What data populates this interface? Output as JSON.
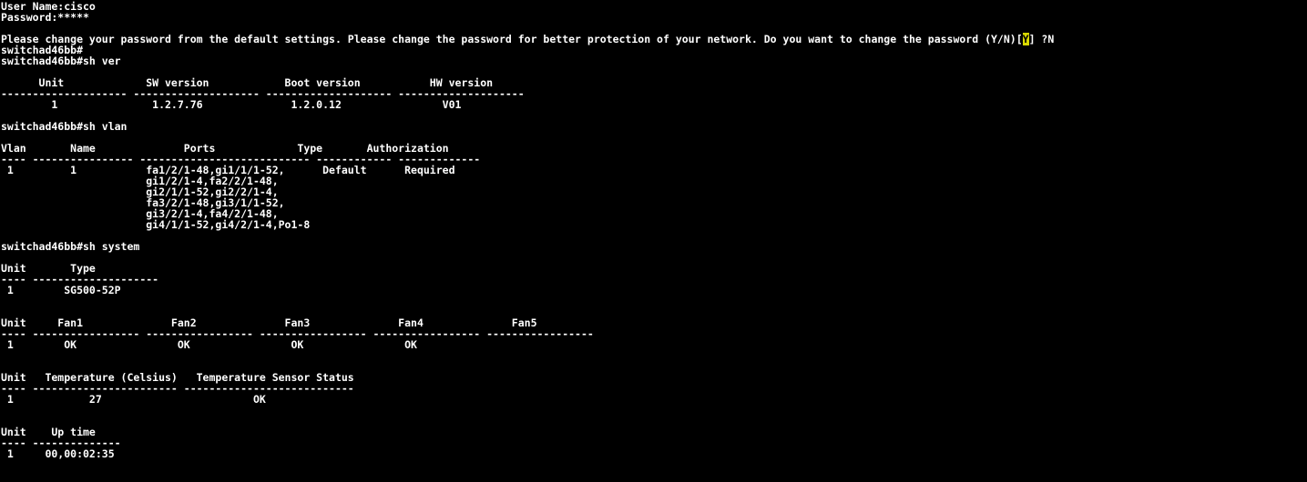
{
  "terminal": {
    "foreground_color": "#ffffff",
    "background_color": "#000000",
    "highlight_color": "#d8d800",
    "prompt": "switchad46bb#",
    "login": {
      "username_line": "User Name:cisco",
      "password_line": "Password:*****",
      "username_label": "User Name:",
      "username_value": "cisco",
      "password_label": "Password:",
      "password_masked": "*****"
    },
    "password_warning": {
      "full_line_prefix": "Please change your password from the default settings. Please change the password for better protection of your network. Do you want to change the password (Y/N)[",
      "default_answer": "Y",
      "full_line_suffix": "] ?N",
      "typed_response": "N"
    },
    "commands": {
      "show_version": "sh ver",
      "show_vlan": "sh vlan",
      "show_system": "sh system"
    },
    "lines": [
      "User Name:cisco",
      "Password:*****",
      "",
      "__WARNING__",
      "switchad46bb#",
      "switchad46bb#sh ver",
      "",
      "      Unit             SW version            Boot version           HW version",
      "-------------------- -------------------- -------------------- --------------------",
      "        1               1.2.7.76              1.2.0.12                V01",
      "",
      "switchad46bb#sh vlan",
      "",
      "Vlan       Name              Ports             Type       Authorization",
      "---- ---------------- --------------------------- ------------ -------------",
      " 1         1           fa1/2/1-48,gi1/1/1-52,      Default      Required",
      "                       gi1/2/1-4,fa2/2/1-48,",
      "                       gi2/1/1-52,gi2/2/1-4,",
      "                       fa3/2/1-48,gi3/1/1-52,",
      "                       gi3/2/1-4,fa4/2/1-48,",
      "                       gi4/1/1-52,gi4/2/1-4,Po1-8",
      "",
      "switchad46bb#sh system",
      "",
      "Unit       Type",
      "---- --------------------",
      " 1        SG500-52P",
      "",
      "",
      "Unit     Fan1              Fan2              Fan3              Fan4              Fan5",
      "---- ----------------- ----------------- ----------------- ----------------- -----------------",
      " 1        OK                OK                OK                OK",
      "",
      "",
      "Unit   Temperature (Celsius)   Temperature Sensor Status",
      "---- ----------------------- ---------------------------",
      " 1            27                        OK",
      "",
      "",
      "Unit    Up time",
      "---- --------------",
      " 1     00,00:02:35"
    ],
    "show_version_table": {
      "headers": [
        "Unit",
        "SW version",
        "Boot version",
        "HW version"
      ],
      "rows": [
        [
          "1",
          "1.2.7.76",
          "1.2.0.12",
          "V01"
        ]
      ]
    },
    "show_vlan_table": {
      "headers": [
        "Vlan",
        "Name",
        "Ports",
        "Type",
        "Authorization"
      ],
      "rows": [
        {
          "vlan": "1",
          "name": "1",
          "ports": [
            "fa1/2/1-48,gi1/1/1-52,",
            "gi1/2/1-4,fa2/2/1-48,",
            "gi2/1/1-52,gi2/2/1-4,",
            "fa3/2/1-48,gi3/1/1-52,",
            "gi3/2/1-4,fa4/2/1-48,",
            "gi4/1/1-52,gi4/2/1-4,Po1-8"
          ],
          "type": "Default",
          "authorization": "Required"
        }
      ]
    },
    "show_system_type_table": {
      "headers": [
        "Unit",
        "Type"
      ],
      "rows": [
        [
          "1",
          "SG500-52P"
        ]
      ]
    },
    "show_system_fan_table": {
      "headers": [
        "Unit",
        "Fan1",
        "Fan2",
        "Fan3",
        "Fan4",
        "Fan5"
      ],
      "rows": [
        [
          "1",
          "OK",
          "OK",
          "OK",
          "OK",
          ""
        ]
      ]
    },
    "show_system_temperature_table": {
      "headers": [
        "Unit",
        "Temperature (Celsius)",
        "Temperature Sensor Status"
      ],
      "rows": [
        [
          "1",
          "27",
          "OK"
        ]
      ]
    },
    "show_system_uptime_table": {
      "headers": [
        "Unit",
        "Up time"
      ],
      "rows": [
        [
          "1",
          "00,00:02:35"
        ]
      ]
    }
  }
}
